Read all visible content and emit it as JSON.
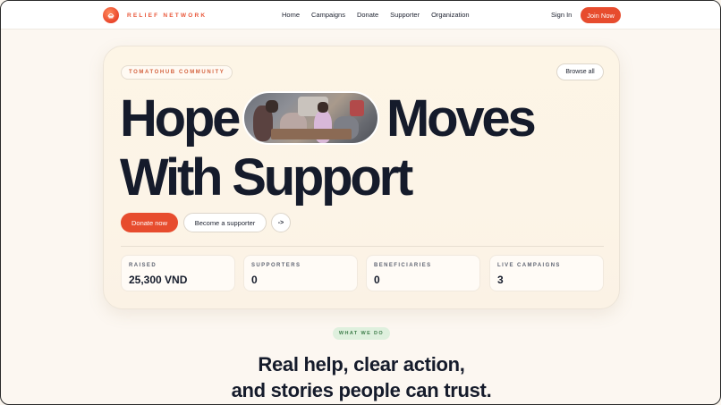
{
  "nav": {
    "brand": "RELIEF NETWORK",
    "links": [
      "Home",
      "Campaigns",
      "Donate",
      "Supporter",
      "Organization"
    ],
    "sign_in": "Sign In",
    "join": "Join Now"
  },
  "hero": {
    "tag": "TOMATOHUB COMMUNITY",
    "browse": "Browse all",
    "headline_1a": "Hope",
    "headline_1b": "Moves",
    "headline_2": "With Support",
    "donate_btn": "Donate now",
    "supporter_btn": "Become a supporter",
    "arrow_btn": "->",
    "stats": [
      {
        "label": "RAISED",
        "value": "25,300 VND"
      },
      {
        "label": "SUPPORTERS",
        "value": "0"
      },
      {
        "label": "BENEFICIARIES",
        "value": "0"
      },
      {
        "label": "LIVE CAMPAIGNS",
        "value": "3"
      }
    ]
  },
  "section": {
    "badge": "WHAT WE DO",
    "title_1": "Real help, clear action,",
    "title_2": "and stories people can trust."
  },
  "colors": {
    "accent": "#e74c2e",
    "background": "#fcf7f1",
    "badge_green": "#dff0de"
  }
}
